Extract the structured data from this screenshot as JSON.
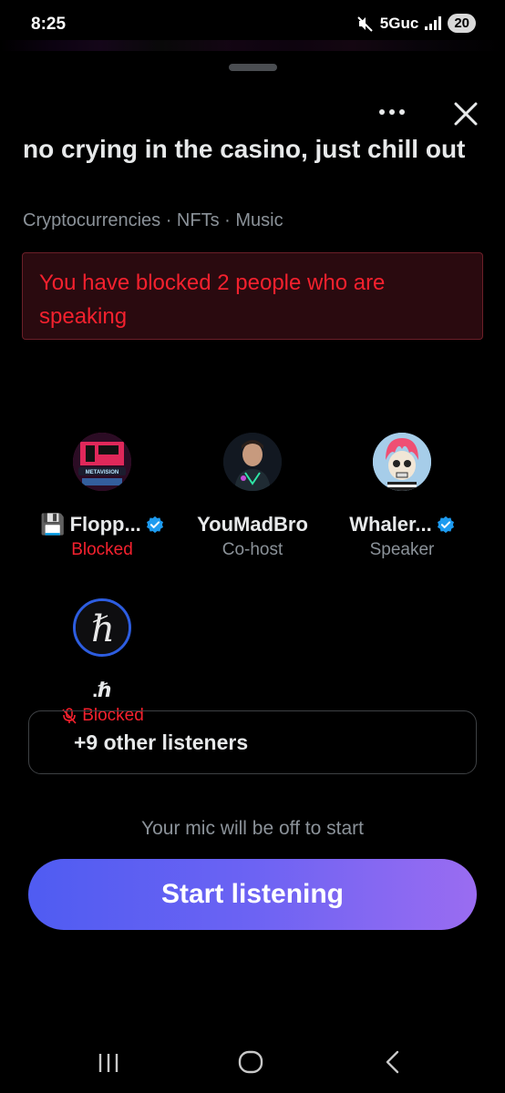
{
  "status_bar": {
    "time": "8:25",
    "network": "5Guc",
    "battery": "20",
    "icons": [
      "mute-icon",
      "signal-icon"
    ]
  },
  "space": {
    "title": "no crying in the casino, just chill out",
    "topics": "Cryptocurrencies · NFTs · Music",
    "blocked_notice": "You have blocked 2 people who are speaking"
  },
  "participants": [
    {
      "emoji": "💾",
      "name": "Flopp...",
      "verified": true,
      "role": "Blocked",
      "role_status": "blocked",
      "avatar_text": "METAVISION",
      "muted": false
    },
    {
      "emoji": "",
      "name": "YouMadBro",
      "verified": false,
      "role": "Co-host",
      "role_status": "normal",
      "muted": false
    },
    {
      "emoji": "",
      "name": "Whaler...",
      "verified": true,
      "role": "Speaker",
      "role_status": "normal",
      "muted": false
    },
    {
      "emoji": "",
      "name": ".ℏ",
      "verified": false,
      "role": "Blocked",
      "role_status": "blocked",
      "avatar_text": "ℏ",
      "muted": true
    }
  ],
  "listeners_button": "+9 other listeners",
  "mic_note": "Your mic will be off to start",
  "start_button": "Start listening",
  "colors": {
    "background": "#000000",
    "blocked_red": "#f4212e",
    "verified_blue": "#1d9bf0",
    "start_gradient_start": "#4f5cf2",
    "start_gradient_end": "#9a6cf1"
  }
}
